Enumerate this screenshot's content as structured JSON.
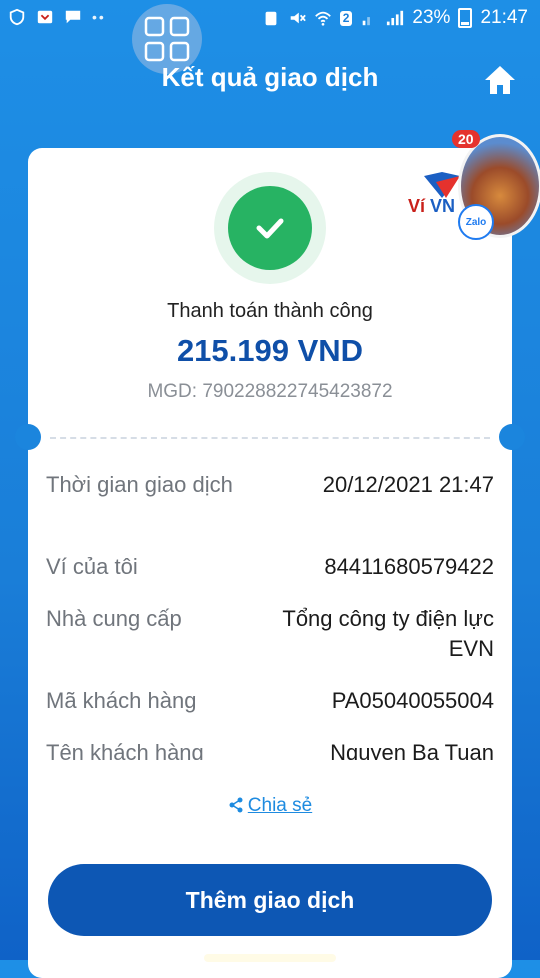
{
  "status_bar": {
    "signal_badge": "2",
    "battery": "23%",
    "time": "21:47"
  },
  "header": {
    "title": "Kết quả giao dịch"
  },
  "result": {
    "status": "Thanh toán thành công",
    "amount": "215.199 VND",
    "transaction_id": "MGD: 790228822745423872"
  },
  "details": [
    {
      "label": "Thời gian giao dịch",
      "value": "20/12/2021 21:47"
    },
    {
      "label": "Ví của tôi",
      "value": "84411680579422"
    },
    {
      "label": "Nhà cung cấp",
      "value": "Tổng công ty điện lực EVN"
    },
    {
      "label": "Mã khách hàng",
      "value": "PA05040055004"
    },
    {
      "label": "Tên khách hàng",
      "value": "Nguyen Ba Tuan"
    }
  ],
  "share": {
    "label": "Chia sẻ"
  },
  "actions": {
    "add_transaction": "Thêm giao dịch"
  },
  "promo": {
    "logo_text_left": "Ví",
    "logo_text_right": "VN",
    "badge": "20",
    "zalo": "Zalo"
  },
  "colors": {
    "primary": "#0d57b4",
    "success": "#27b363",
    "background": "#1a7ed8"
  }
}
